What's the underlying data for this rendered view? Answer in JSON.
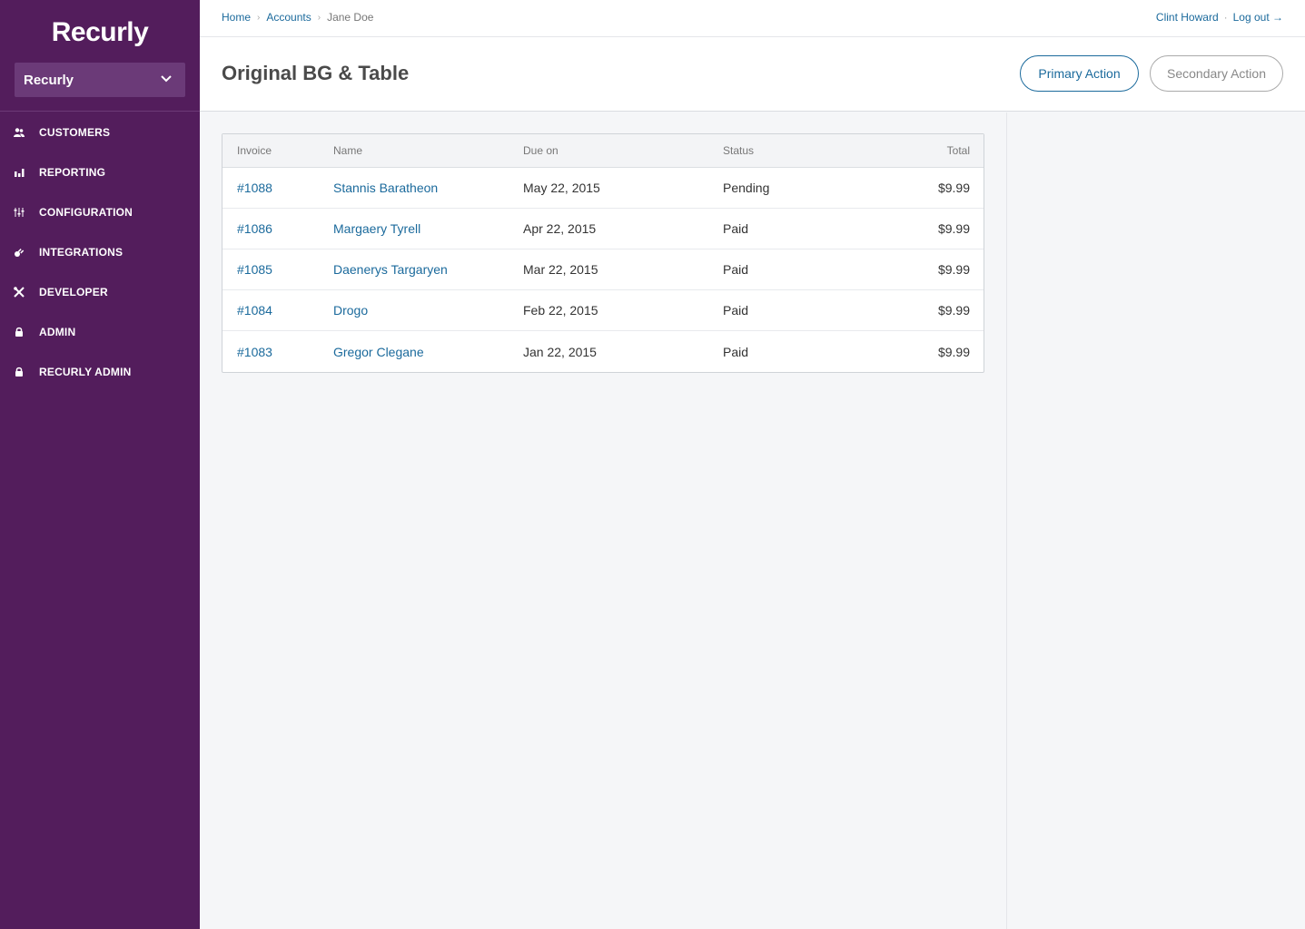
{
  "sidebar": {
    "logo": "Recurly",
    "site_selector": "Recurly",
    "items": [
      {
        "label": "CUSTOMERS",
        "icon": "users-icon"
      },
      {
        "label": "REPORTING",
        "icon": "bar-chart-icon"
      },
      {
        "label": "CONFIGURATION",
        "icon": "sliders-icon"
      },
      {
        "label": "INTEGRATIONS",
        "icon": "plug-icon"
      },
      {
        "label": "DEVELOPER",
        "icon": "tools-icon"
      },
      {
        "label": "ADMIN",
        "icon": "lock-icon"
      },
      {
        "label": "RECURLY ADMIN",
        "icon": "lock-icon"
      }
    ]
  },
  "breadcrumb": {
    "home": "Home",
    "accounts": "Accounts",
    "current": "Jane Doe",
    "separator": "›"
  },
  "user_nav": {
    "user": "Clint Howard",
    "separator": "·",
    "logout": "Log out →"
  },
  "header": {
    "title": "Original BG & Table",
    "primary_action": "Primary Action",
    "secondary_action": "Secondary Action"
  },
  "table": {
    "columns": [
      "Invoice",
      "Name",
      "Due on",
      "Status",
      "Total"
    ],
    "rows": [
      {
        "invoice": "#1088",
        "name": "Stannis Baratheon",
        "due": "May 22, 2015",
        "status": "Pending",
        "total": "$9.99"
      },
      {
        "invoice": "#1086",
        "name": "Margaery Tyrell",
        "due": "Apr 22, 2015",
        "status": "Paid",
        "total": "$9.99"
      },
      {
        "invoice": "#1085",
        "name": "Daenerys Targaryen",
        "due": "Mar 22, 2015",
        "status": "Paid",
        "total": "$9.99"
      },
      {
        "invoice": "#1084",
        "name": "Drogo",
        "due": "Feb 22, 2015",
        "status": "Paid",
        "total": "$9.99"
      },
      {
        "invoice": "#1083",
        "name": "Gregor Clegane",
        "due": "Jan 22, 2015",
        "status": "Paid",
        "total": "$9.99"
      }
    ]
  },
  "colors": {
    "sidebar": "#531d5c",
    "link": "#1b6a9c",
    "background": "#f5f6f8"
  }
}
